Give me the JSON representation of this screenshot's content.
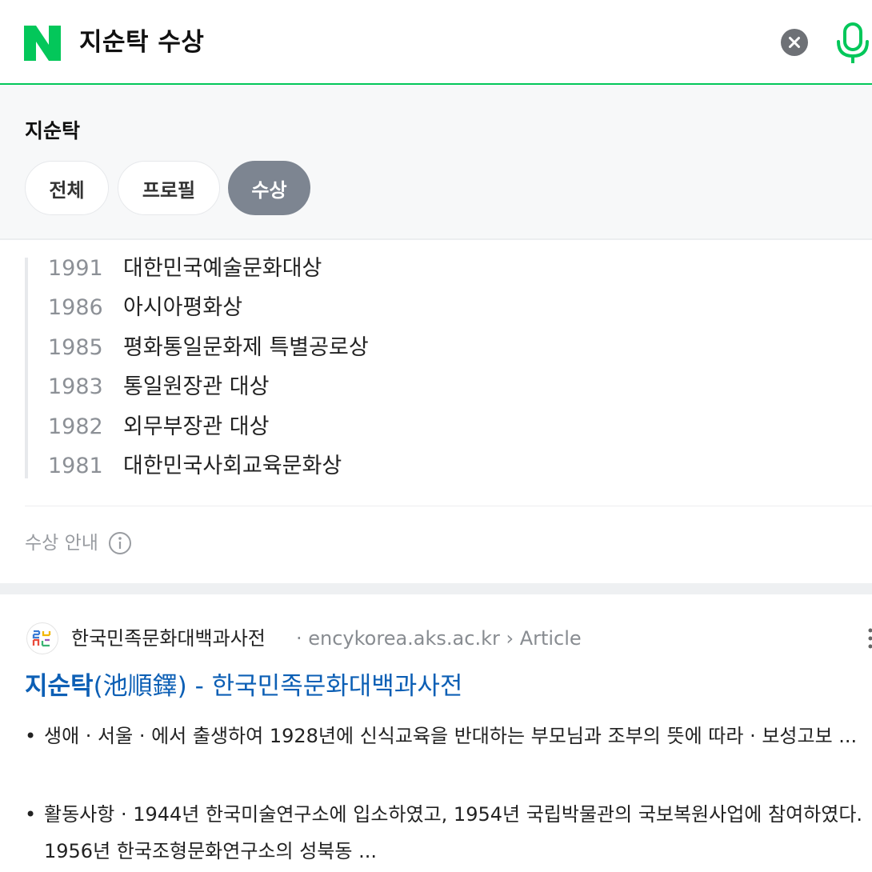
{
  "search": {
    "query": "지순탁 수상",
    "colors": {
      "accent": "#03c75a",
      "link": "#0c5fb5",
      "chip_active": "#7d8591"
    }
  },
  "entity": {
    "title": "지순탁",
    "tabs": [
      {
        "label": "전체",
        "active": false
      },
      {
        "label": "프로필",
        "active": false
      },
      {
        "label": "수상",
        "active": true
      }
    ]
  },
  "awards": [
    {
      "year": "1991",
      "name": "대한민국예술문화대상"
    },
    {
      "year": "1986",
      "name": "아시아평화상"
    },
    {
      "year": "1985",
      "name": "평화통일문화제 특별공로상"
    },
    {
      "year": "1983",
      "name": "통일원장관 대상"
    },
    {
      "year": "1982",
      "name": "외무부장관 대상"
    },
    {
      "year": "1981",
      "name": "대한민국사회교육문화상"
    }
  ],
  "awards_guide": "수상 안내",
  "result": {
    "site_name": "한국민족문화대백과사전",
    "site_url": "· encykorea.aks.ac.kr › Article",
    "title_strong": "지순탁",
    "title_rest": "(池順鐸) - 한국민족문화대백과사전",
    "bullets": [
      "생애 · 서울 · 에서 출생하여 1928년에 신식교육을 반대하는 부모님과 조부의 뜻에 따라 · 보성고보 ...",
      "활동사항 · 1944년 한국미술연구소에 입소하였고, 1954년 국립박물관의 국보복원사업에 참여하였다. 1956년 한국조형문화연구소의 성북동 ..."
    ]
  }
}
